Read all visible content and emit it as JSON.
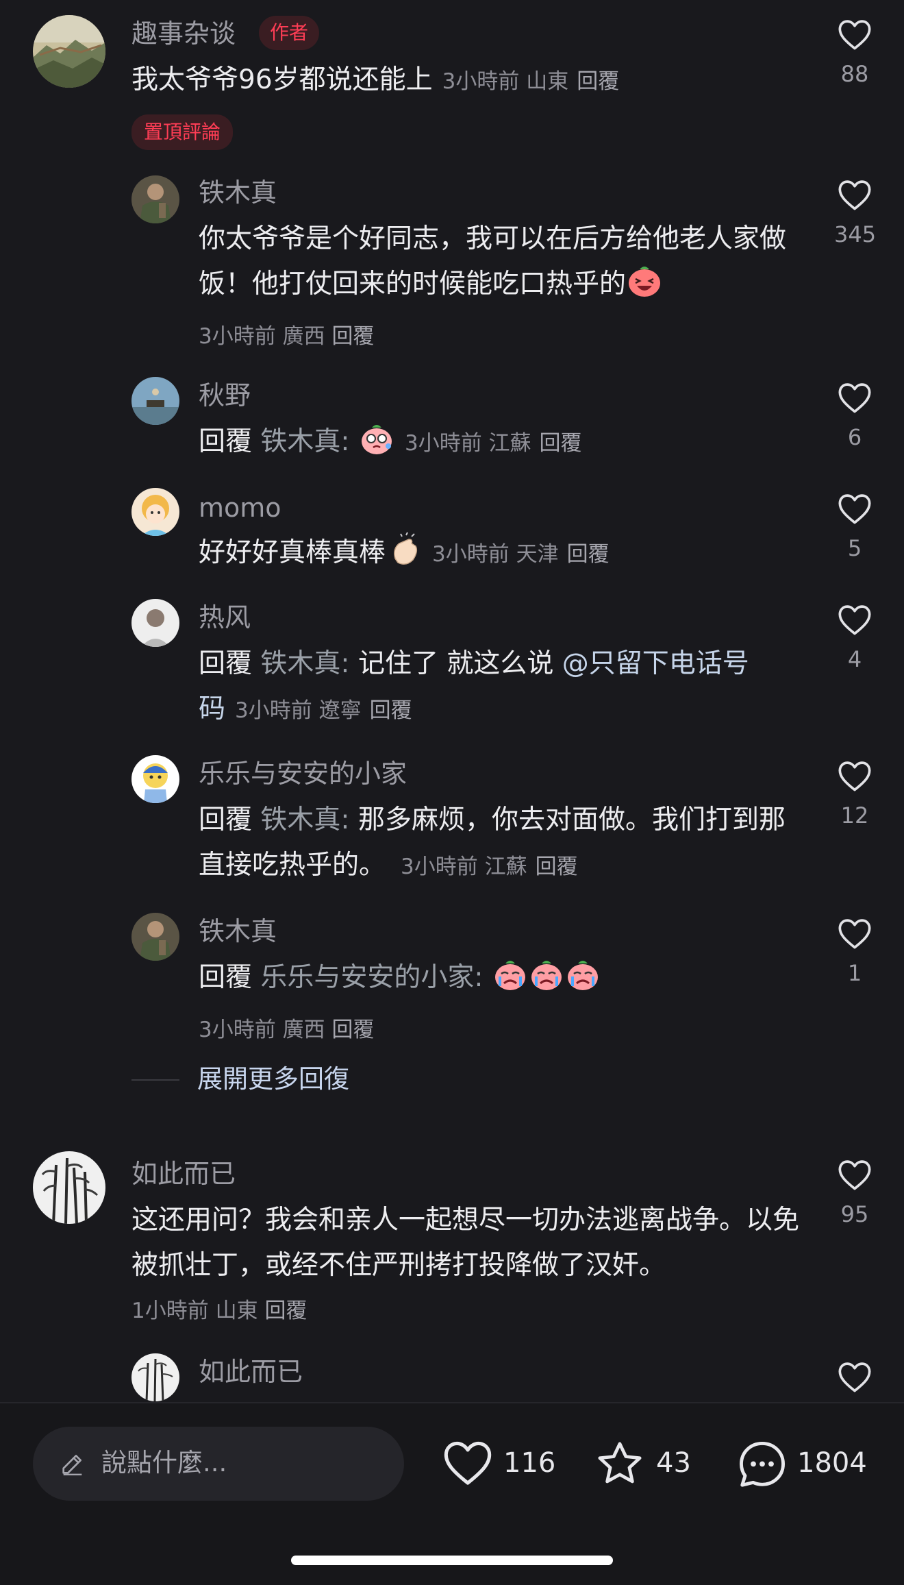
{
  "pinned_comment": {
    "username": "趣事杂谈",
    "author_badge": "作者",
    "text": "我太爷爷96岁都说还能上",
    "meta": "3小時前 山東",
    "reply_label": "回覆",
    "pinned_badge": "置頂評論",
    "likes": "88"
  },
  "replies": [
    {
      "username": "铁木真",
      "text": "你太爷爷是个好同志，我可以在后方给他老人家做饭！他打仗回来的时候能吃口热乎的",
      "emoji": "laugh",
      "meta": "3小時前 廣西",
      "reply_label": "回覆",
      "likes": "345"
    },
    {
      "username": "秋野",
      "prefix": "回覆",
      "mention": "铁木真:",
      "emoji": "shy",
      "meta": "3小時前 江蘇",
      "reply_label": "回覆",
      "likes": "6"
    },
    {
      "username": "momo",
      "text": "好好好真棒真棒",
      "emoji": "clap",
      "meta": "3小時前 天津",
      "reply_label": "回覆",
      "likes": "5"
    },
    {
      "username": "热风",
      "prefix": "回覆",
      "mention": "铁木真:",
      "text": "记住了 就这么说 ",
      "at_mention_1": "@只留下电话号",
      "at_mention_2": "码",
      "meta": "3小時前 遼寧",
      "reply_label": "回覆",
      "likes": "4"
    },
    {
      "username": "乐乐与安安的小家",
      "prefix": "回覆",
      "mention": "铁木真:",
      "text": "那多麻烦，你去对面做。我们打到那直接吃热乎的。",
      "meta": "3小時前 江蘇",
      "reply_label": "回覆",
      "likes": "12"
    },
    {
      "username": "铁木真",
      "prefix": "回覆",
      "mention": "乐乐与安安的小家:",
      "emoji": "cry",
      "meta": "3小時前 廣西",
      "reply_label": "回覆",
      "likes": "1"
    }
  ],
  "expand_more": "展開更多回復",
  "second_comment": {
    "username": "如此而已",
    "text": "这还用问？我会和亲人一起想尽一切办法逃离战争。以免被抓壮丁，或经不住严刑拷打投降做了汉奸。",
    "meta": "1小時前 山東",
    "reply_label": "回覆",
    "likes": "95"
  },
  "partial_reply": {
    "username": "如此而已"
  },
  "bottom_bar": {
    "input_placeholder": "說點什麼...",
    "likes": "116",
    "favorites": "43",
    "comments": "1804"
  },
  "colors": {
    "background": "#19191d",
    "accent_red": "#ff3d55",
    "badge_bg": "#3a1d22",
    "link_blue": "#c8d6ee"
  },
  "icons": [
    "heart-icon",
    "pencil-icon",
    "star-icon",
    "comment-bubble-icon"
  ]
}
